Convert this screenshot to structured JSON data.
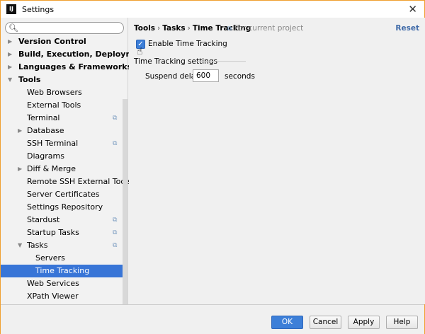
{
  "window": {
    "title": "Settings",
    "app_icon": "IJ"
  },
  "search": {
    "placeholder": ""
  },
  "tree": [
    {
      "label": "Version Control",
      "level": 0,
      "bold": true,
      "arrow": "right"
    },
    {
      "label": "Build, Execution, Deployment",
      "level": 0,
      "bold": true,
      "arrow": "right"
    },
    {
      "label": "Languages & Frameworks",
      "level": 0,
      "bold": true,
      "arrow": "right"
    },
    {
      "label": "Tools",
      "level": 0,
      "bold": true,
      "arrow": "down"
    },
    {
      "label": "Web Browsers",
      "level": 1
    },
    {
      "label": "External Tools",
      "level": 1
    },
    {
      "label": "Terminal",
      "level": 1,
      "project": true
    },
    {
      "label": "Database",
      "level": 1,
      "arrow": "right"
    },
    {
      "label": "SSH Terminal",
      "level": 1,
      "project": true
    },
    {
      "label": "Diagrams",
      "level": 1
    },
    {
      "label": "Diff & Merge",
      "level": 1,
      "arrow": "right"
    },
    {
      "label": "Remote SSH External Tools",
      "level": 1
    },
    {
      "label": "Server Certificates",
      "level": 1
    },
    {
      "label": "Settings Repository",
      "level": 1
    },
    {
      "label": "Stardust",
      "level": 1,
      "project": true
    },
    {
      "label": "Startup Tasks",
      "level": 1,
      "project": true
    },
    {
      "label": "Tasks",
      "level": 1,
      "arrow": "down",
      "project": true
    },
    {
      "label": "Servers",
      "level": 2
    },
    {
      "label": "Time Tracking",
      "level": 2,
      "selected": true
    },
    {
      "label": "Web Services",
      "level": 1
    },
    {
      "label": "XPath Viewer",
      "level": 1
    }
  ],
  "breadcrumb": {
    "items": [
      "Tools",
      "Tasks",
      "Time Tracking"
    ],
    "sep": "›",
    "scope": "For current project"
  },
  "reset_label": "Reset",
  "enable": {
    "label": "Enable Time Tracking",
    "checked": true
  },
  "group_title": "Time Tracking settings",
  "suspend": {
    "label": "Suspend delay:",
    "value": "600",
    "unit": "seconds"
  },
  "buttons": {
    "ok": "OK",
    "cancel": "Cancel",
    "apply": "Apply",
    "help": "Help"
  },
  "colors": {
    "accent": "#3875d7",
    "link": "#3f6aa8"
  }
}
